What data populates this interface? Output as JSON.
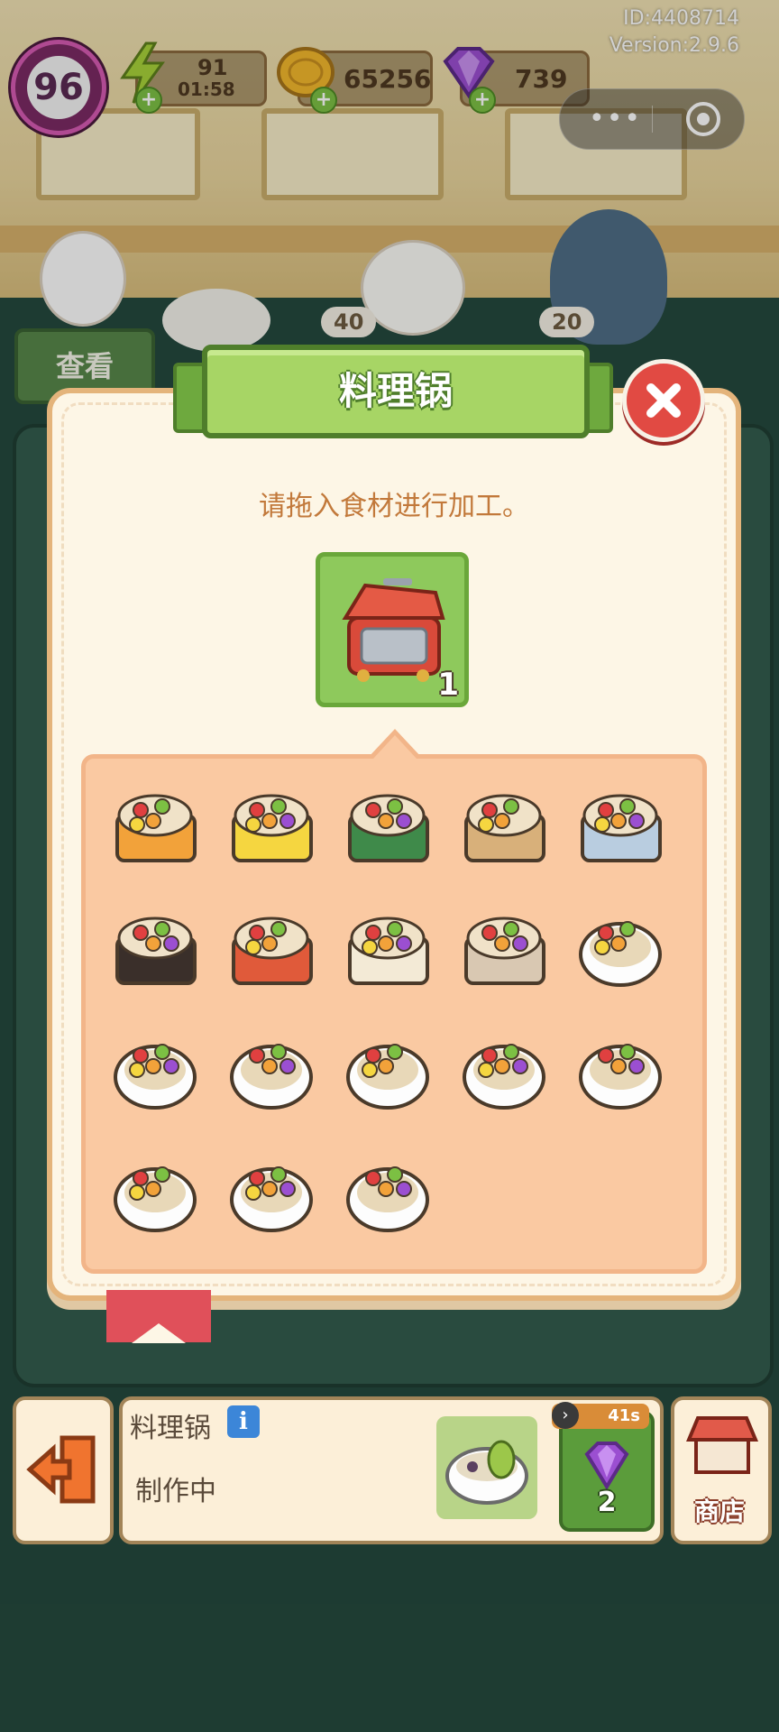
{
  "hud": {
    "id": "ID:4408714",
    "version": "Version:2.9.6",
    "level": "96",
    "energy": "91",
    "energy_timer": "01:58",
    "coins": "65256",
    "gems": "739"
  },
  "scene": {
    "view_button": "查看",
    "tag1": "40",
    "tag2": "20"
  },
  "dialog": {
    "title": "料理锅",
    "hint": "请拖入食材进行加工。",
    "pot_count": "1",
    "recipes": [
      {
        "icon": "salmon-bento-icon"
      },
      {
        "icon": "shrimp-bento-icon"
      },
      {
        "icon": "veggie-bento-icon"
      },
      {
        "icon": "fish-bento-icon"
      },
      {
        "icon": "roll-bento-icon"
      },
      {
        "icon": "sashimi-bento-icon"
      },
      {
        "icon": "ham-bento-icon"
      },
      {
        "icon": "meatball-bento-icon"
      },
      {
        "icon": "steak-bento-icon"
      },
      {
        "icon": "tomato-salad-icon"
      },
      {
        "icon": "berry-salad-icon"
      },
      {
        "icon": "orange-salad-icon"
      },
      {
        "icon": "avocado-bowl-icon"
      },
      {
        "icon": "carrot-salad-icon"
      },
      {
        "icon": "chicken-salad-icon"
      },
      {
        "icon": "lemon-salad-icon"
      },
      {
        "icon": "avocado-salad-icon"
      },
      {
        "icon": "fruit-bowl-icon"
      }
    ]
  },
  "bottom_bar": {
    "station_name": "料理锅",
    "status": "制作中",
    "timer": "41s",
    "speedup_cost": "2",
    "shop_label": "商店"
  }
}
